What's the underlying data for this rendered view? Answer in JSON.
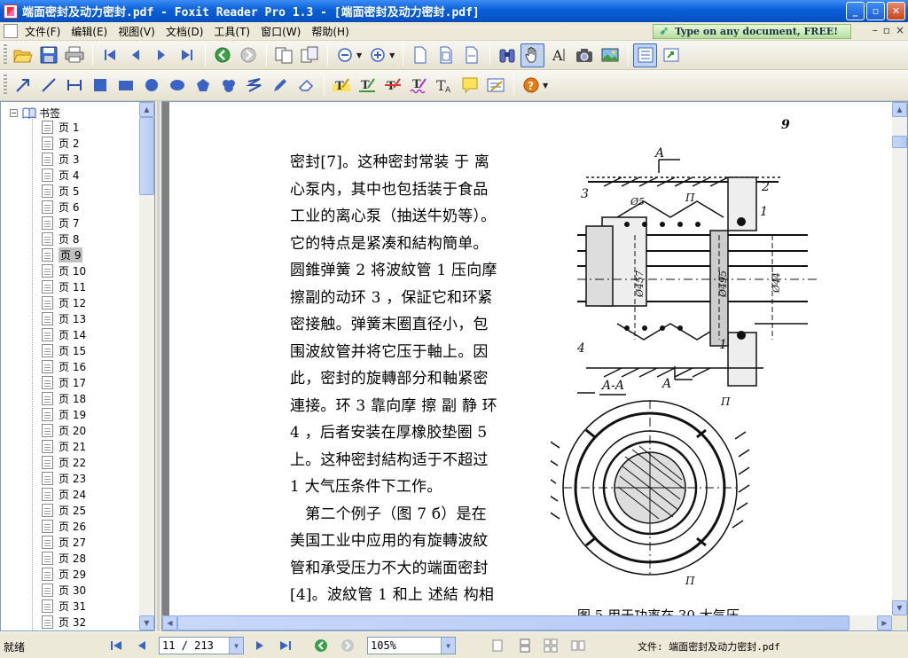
{
  "window": {
    "title": "端面密封及动力密封.pdf - Foxit Reader Pro 1.3 - [端面密封及动力密封.pdf]",
    "minimize": "_",
    "maximize": "▫",
    "close": "✕"
  },
  "menu": {
    "items": [
      "文件(F)",
      "编辑(E)",
      "视图(V)",
      "文档(D)",
      "工具(T)",
      "窗口(W)",
      "帮助(H)"
    ],
    "ad_text": "Type on any document, FREE!",
    "mdi_min": "–",
    "mdi_restore": "▫",
    "mdi_close": "×"
  },
  "bookmarks": {
    "root_label": "书签",
    "expander": "−",
    "pages": [
      "页 1",
      "页 2",
      "页 3",
      "页 4",
      "页 5",
      "页 6",
      "页 7",
      "页 8",
      "页 9",
      "页 10",
      "页 11",
      "页 12",
      "页 13",
      "页 14",
      "页 15",
      "页 16",
      "页 17",
      "页 18",
      "页 19",
      "页 20",
      "页 21",
      "页 22",
      "页 23",
      "页 24",
      "页 25",
      "页 26",
      "页 27",
      "页 28",
      "页 29",
      "页 30",
      "页 31",
      "页 32"
    ],
    "selected_index": 8
  },
  "document": {
    "page_number": "9",
    "text_lines": [
      "密封[7]。这种密封常装 于 离",
      "心泵内，其中也包括装于食品",
      "工业的离心泵（抽送牛奶等）。",
      "它的特点是紧凑和結构簡单。",
      "圆錐弹簧 2 将波紋管 1 压向摩",
      "擦副的动环 3 ，保証它和环紧",
      "密接触。弹簧末圈直径小，包",
      "围波紋管并将它压于軸上。因",
      "此，密封的旋轉部分和軸紧密",
      "連接。环 3 靠向摩 擦 副 静 环",
      "4 ，后者安装在厚橡胶垫圈 5",
      "上。这种密封結构适于不超过",
      "1 大气压条件下工作。",
      "　第二个例子（图 7 б）是在",
      "美国工业中应用的有旋轉波紋",
      "管和承受压力不大的端面密封",
      "[4]。波紋管 1 和上 述結 构相"
    ],
    "figure_labels": {
      "section_top": "A",
      "n1": "3",
      "n2": "2",
      "n3": "1",
      "n4": "4",
      "n5": "1",
      "phi5": "Ø5",
      "p_top": "П",
      "d1": "Ø457",
      "d2": "Ø495",
      "d3": "Ø44",
      "section_aa": "A-A",
      "section_bottom": "A",
      "p_mid": "П",
      "p_bottom": "П"
    },
    "caption": "图 5 用于功率在 30 大气压"
  },
  "status": {
    "ready": "就绪",
    "page_indicator": "11 / 213",
    "zoom": "105%",
    "file": "文件: 端面密封及动力密封.pdf"
  },
  "colors": {
    "titlebar": "#0653c6",
    "chrome": "#ece9d8",
    "selection": "#c0c0c0",
    "doc_background": "#808080"
  }
}
